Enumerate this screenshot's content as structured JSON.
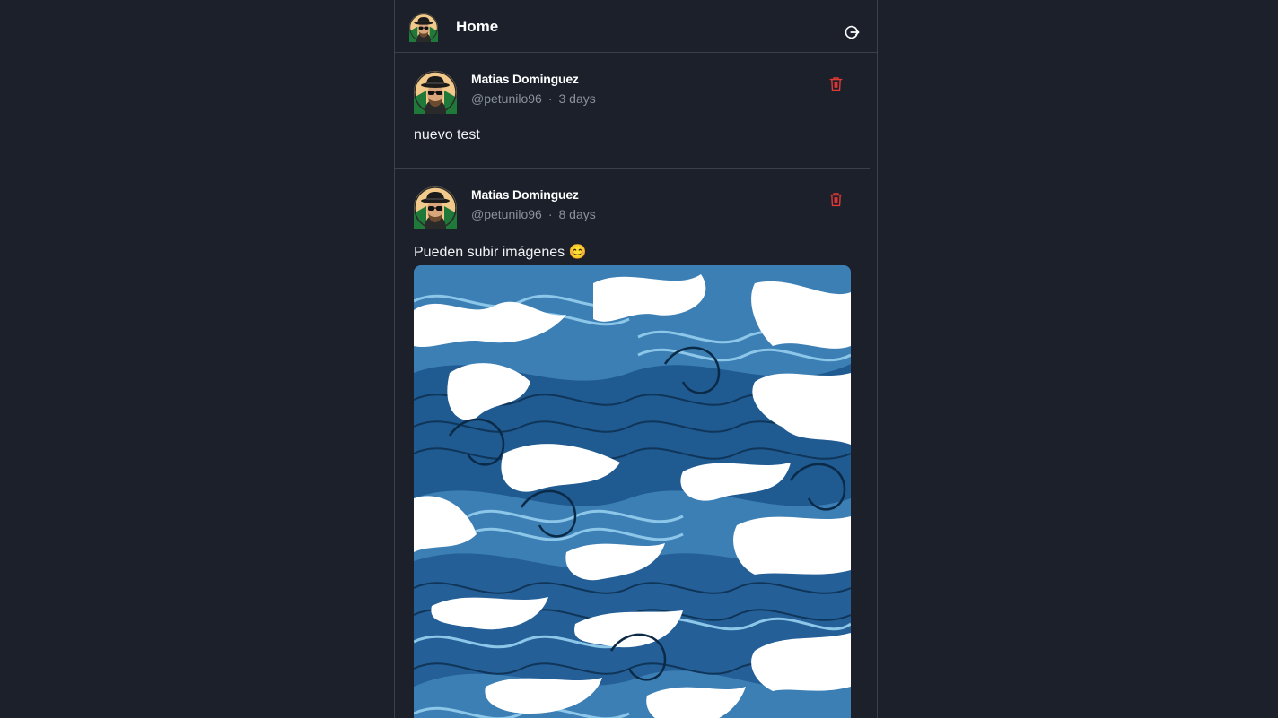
{
  "header": {
    "title": "Home",
    "avatar_icon": "user-avatar-icon",
    "logout_icon": "logout-icon"
  },
  "posts": [
    {
      "author": "Matias Dominguez",
      "handle": "@petunilo96",
      "separator": "·",
      "time": "3 days",
      "text": "nuevo test",
      "delete_icon": "trash-icon"
    },
    {
      "author": "Matias Dominguez",
      "handle": "@petunilo96",
      "separator": "·",
      "time": "8 days",
      "text": "Pueden subir imágenes 😊",
      "image": "ocean-waves-illustration",
      "delete_icon": "trash-icon"
    }
  ],
  "colors": {
    "background": "#1b202b",
    "border": "#3a404c",
    "muted_text": "#8b919c",
    "delete_red": "#e53935"
  }
}
